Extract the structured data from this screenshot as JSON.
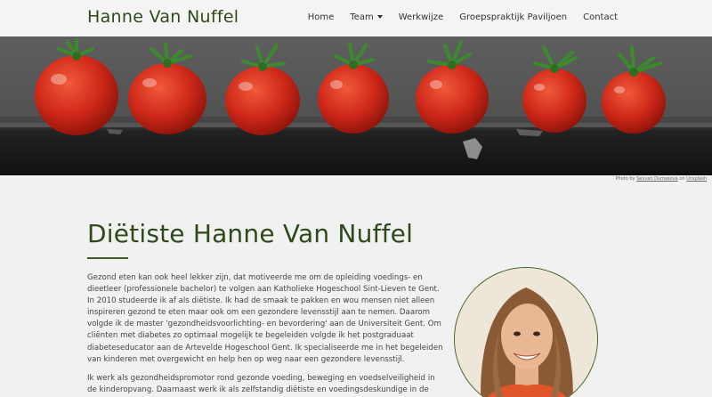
{
  "site": {
    "brand": "Hanne Van Nuffel"
  },
  "nav": {
    "items": [
      {
        "label": "Home"
      },
      {
        "label": "Team"
      },
      {
        "label": "Werkwijze"
      },
      {
        "label": "Groepspraktijk Paviljoen"
      },
      {
        "label": "Contact"
      }
    ]
  },
  "hero": {
    "credit_prefix": "Photo by ",
    "credit_author": "Sevvan Dumasova",
    "credit_middle": " on ",
    "credit_source": "Unsplash"
  },
  "main": {
    "title": "Diëtiste Hanne Van Nuffel",
    "paragraph1": "Gezond eten kan ook heel lekker zijn, dat motiveerde me om de opleiding voedings- en dieetleer (professionele bachelor) te volgen aan Katholieke Hogeschool Sint-Lieven te Gent. In 2010 studeerde ik af als diëtiste. Ik had de smaak te pakken en wou mensen niet alleen inspireren gezond te eten maar ook om een gezondere levensstijl aan te nemen. Daarom volgde ik de master 'gezondheidsvoorlichting- en bevordering' aan de Universiteit Gent. Om cliënten met diabetes zo optimaal mogelijk te begeleiden volgde ik het postgraduaat diabeteseducator aan de Artevelde Hogeschool Gent. Ik specialiseerde me in het begeleiden van kinderen met overgewicht en help hen op weg naar een gezondere levensstijl.",
    "paragraph2": "Ik werk als gezondheidspromotor rond gezonde voeding, beweging en voedselveiligheid in de kinderopvang. Daarnaast werk ik als zelfstandig diëtiste en voedingsdeskundige in de regio Sint-"
  },
  "colors": {
    "accent": "#2f4a1a",
    "rule": "#3f5e22",
    "background": "#f1f1f1"
  }
}
